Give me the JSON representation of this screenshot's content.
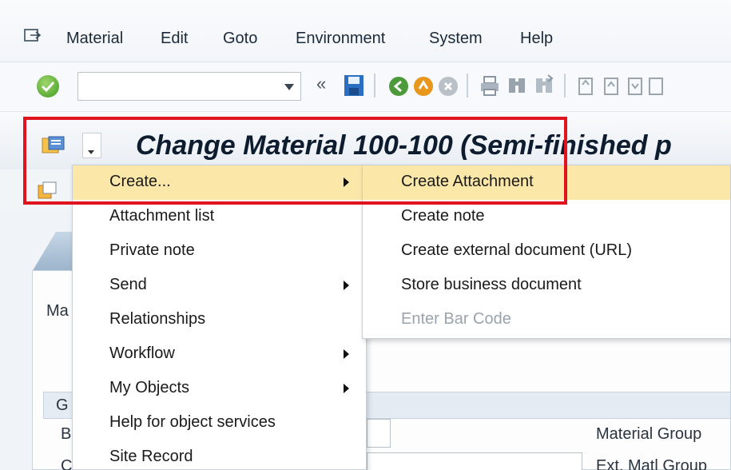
{
  "menubar": {
    "items": [
      "Material",
      "Edit",
      "Goto",
      "Environment",
      "System",
      "Help"
    ]
  },
  "toolbar": {
    "command_field_value": "",
    "back_glyph": "«"
  },
  "title": {
    "text": "Change Material 100-100 (Semi-finished p"
  },
  "context_menu": {
    "items": [
      {
        "label": "Create...",
        "has_submenu": true,
        "active": true
      },
      {
        "label": "Attachment list",
        "has_submenu": false
      },
      {
        "label": "Private note",
        "has_submenu": false
      },
      {
        "label": "Send",
        "has_submenu": true
      },
      {
        "label": "Relationships",
        "has_submenu": false
      },
      {
        "label": "Workflow",
        "has_submenu": true
      },
      {
        "label": "My Objects",
        "has_submenu": true
      },
      {
        "label": "Help for object services",
        "has_submenu": false
      },
      {
        "label": "Site Record",
        "has_submenu": false
      }
    ]
  },
  "submenu": {
    "items": [
      {
        "label": "Create Attachment",
        "active": true
      },
      {
        "label": "Create note"
      },
      {
        "label": "Create external document (URL)"
      },
      {
        "label": "Store business document"
      },
      {
        "label": "Enter Bar Code",
        "disabled": true
      }
    ]
  },
  "background": {
    "left_label_ma": "Ma",
    "group_label_g": "G",
    "row_label_b": "B",
    "row_label_c": "C",
    "material_group_label": "Material Group",
    "ext_matl_group_label": "Ext. Matl Group"
  },
  "colors": {
    "highlight": "#e0141e",
    "menu_active": "#fbe7a8"
  }
}
